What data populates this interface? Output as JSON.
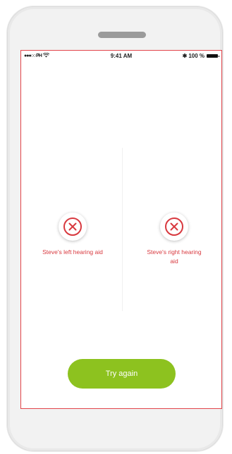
{
  "status_bar": {
    "carrier": "●●●○○ PH",
    "time": "9:41 AM",
    "bluetooth": "✱",
    "battery_percent": "100 %"
  },
  "hearing_aids": {
    "left": {
      "label": "Steve's left hearing aid",
      "status_icon": "x-icon"
    },
    "right": {
      "label": "Steve's right hearing aid",
      "status_icon": "x-icon"
    }
  },
  "actions": {
    "try_again_label": "Try again"
  },
  "colors": {
    "error": "#d8393f",
    "accent": "#8dc21f"
  }
}
